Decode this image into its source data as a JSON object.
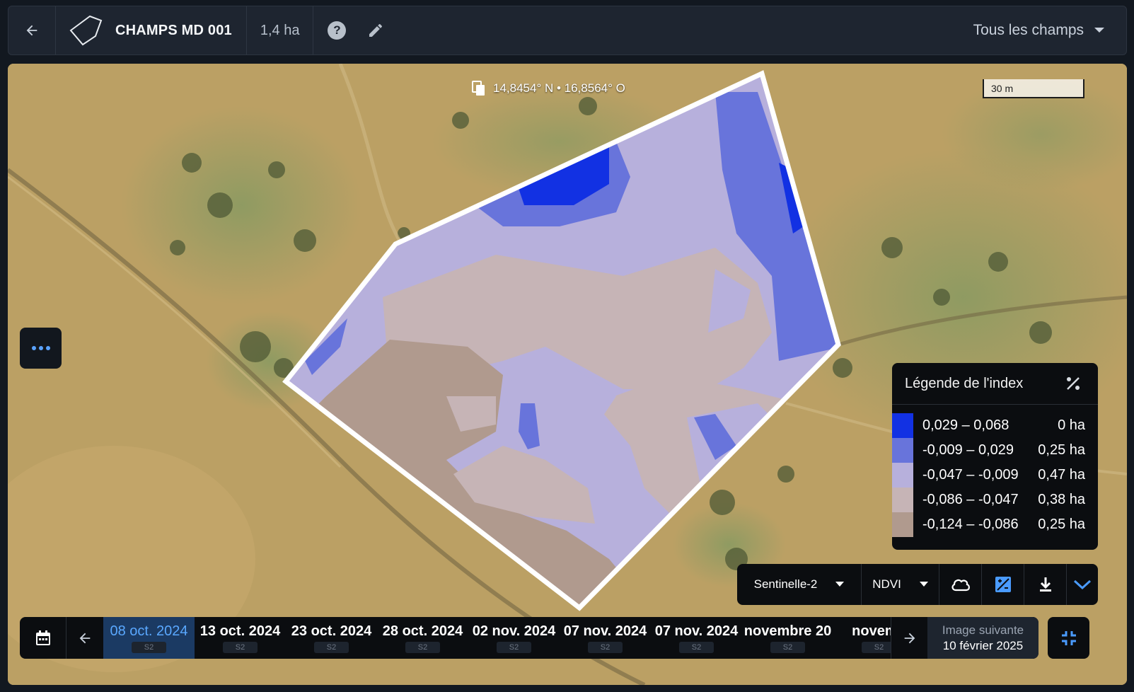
{
  "header": {
    "field_name": "CHAMPS MD 001",
    "area": "1,4 ha",
    "help": "?",
    "selector_label": "Tous les champs",
    "icons": [
      "arrow-left-icon",
      "field-polygon-icon",
      "help-icon",
      "pencil-icon",
      "caret-down-icon"
    ]
  },
  "map": {
    "coordinates": "14,8454° N • 16,8564° O",
    "scale": "30 m"
  },
  "legend": {
    "title": "Légende de l'index",
    "rows": [
      {
        "range": "0,029 – 0,068",
        "area": "0 ha",
        "color": "#1231e3"
      },
      {
        "range": "-0,009 – 0,029",
        "area": "0,25 ha",
        "color": "#6874db"
      },
      {
        "range": "-0,047 – -0,009",
        "area": "0,47 ha",
        "color": "#b7b0dc"
      },
      {
        "range": "-0,086 – -0,047",
        "area": "0,38 ha",
        "color": "#c6b4b6"
      },
      {
        "range": "-0,124 – -0,086",
        "area": "0,25 ha",
        "color": "#b09a8e"
      }
    ]
  },
  "imagery": {
    "sensor": "Sentinelle-2",
    "index": "NDVI",
    "icons": [
      "cloud-icon",
      "image-compare-icon",
      "download-icon",
      "chevron-down-icon"
    ]
  },
  "timeline": {
    "dates": [
      {
        "label": "08 oct. 2024",
        "sat": "S2",
        "active": true
      },
      {
        "label": "13 oct. 2024",
        "sat": "S2"
      },
      {
        "label": "23 oct. 2024",
        "sat": "S2"
      },
      {
        "label": "28 oct. 2024",
        "sat": "S2"
      },
      {
        "label": "02 nov. 2024",
        "sat": "S2"
      },
      {
        "label": "07 nov. 2024",
        "sat": "S2"
      },
      {
        "label": "07 nov. 2024",
        "sat": "S2"
      },
      {
        "label": "novembre 20",
        "sat": "S2"
      },
      {
        "label": "novemb",
        "sat": "S2"
      }
    ],
    "next_image_label": "Image suivante",
    "next_image_date": "10 février 2025"
  },
  "colors": {
    "accent": "#4a9bff",
    "panel": "#0b0d10",
    "header": "#1e2530"
  }
}
